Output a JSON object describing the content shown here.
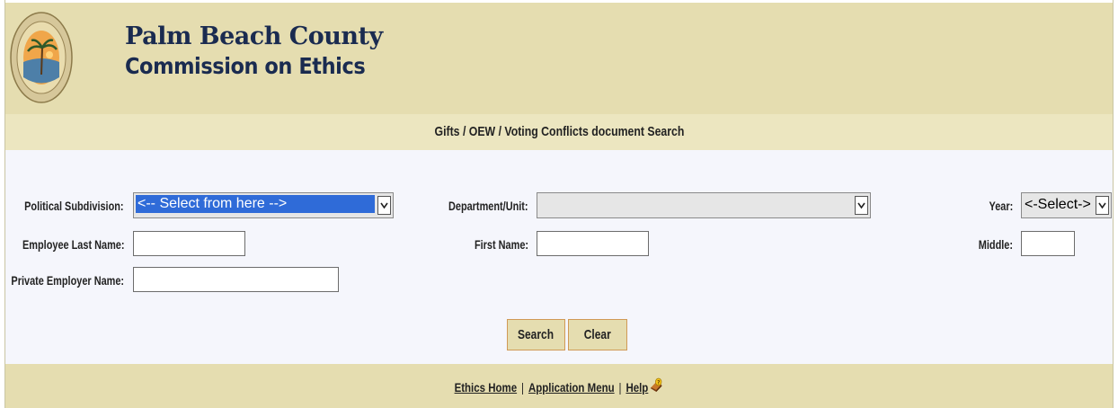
{
  "header": {
    "org_line1": "Palm Beach County",
    "org_line2": "Commission on Ethics",
    "seal_text_top": "PALM BEACH COUNTY",
    "seal_text_bottom": "COMMISSION ON ETHICS"
  },
  "subheader": {
    "title": "Gifts / OEW / Voting Conflicts document Search"
  },
  "form": {
    "political_subdivision": {
      "label": "Political Subdivision:",
      "selected": "<-- Select from here -->"
    },
    "department_unit": {
      "label": "Department/Unit:",
      "selected": ""
    },
    "year": {
      "label": "Year:",
      "selected": "<-Select->"
    },
    "employee_last_name": {
      "label": "Employee Last Name:",
      "value": ""
    },
    "first_name": {
      "label": "First Name:",
      "value": ""
    },
    "middle": {
      "label": "Middle:",
      "value": ""
    },
    "private_employer_name": {
      "label": "Private Employer Name:",
      "value": ""
    },
    "search_label": "Search",
    "clear_label": "Clear"
  },
  "footer": {
    "ethics_home": "Ethics Home",
    "application_menu": "Application Menu",
    "help": "Help",
    "separator": "|"
  },
  "colors": {
    "header_bg": "#e5ddb0",
    "subheader_bg": "#ece6c0",
    "form_bg": "#f5f6fc",
    "brand_text": "#1a2b50",
    "button_border": "#d09a56",
    "select_highlight": "#2f6bd8"
  }
}
